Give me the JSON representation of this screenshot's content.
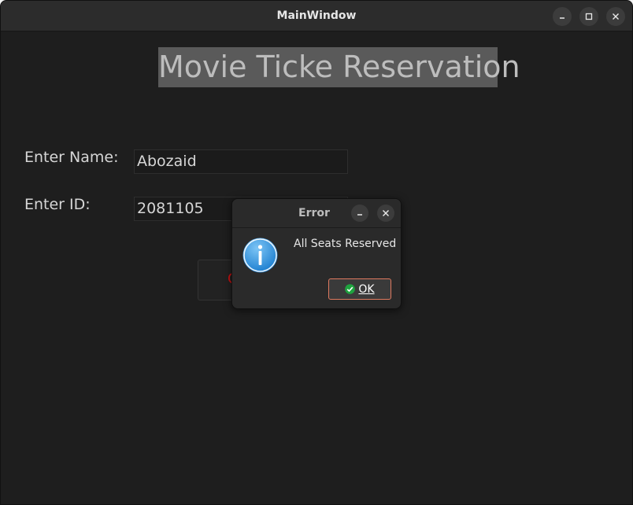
{
  "window": {
    "title": "MainWindow",
    "controls": [
      "minimize-icon",
      "maximize-icon",
      "close-icon"
    ]
  },
  "main": {
    "heading": "Movie Ticke Reservation",
    "name_label": "Enter Name:",
    "name_value": "Abozaid",
    "id_label": "Enter ID:",
    "id_value": "2081105"
  },
  "dialog": {
    "title": "Error",
    "message": "All Seats Reserved",
    "ok_label": "OK",
    "icon": "info-icon",
    "ok_icon": "check-circle-icon"
  },
  "colors": {
    "window_bg": "#1e1e1e",
    "titlebar_bg": "#2c2c2c",
    "heading_bg": "#5a5a5a",
    "ok_border": "#e07a5f",
    "info_blue": "#2a8ad8",
    "check_green": "#1fa33f"
  }
}
